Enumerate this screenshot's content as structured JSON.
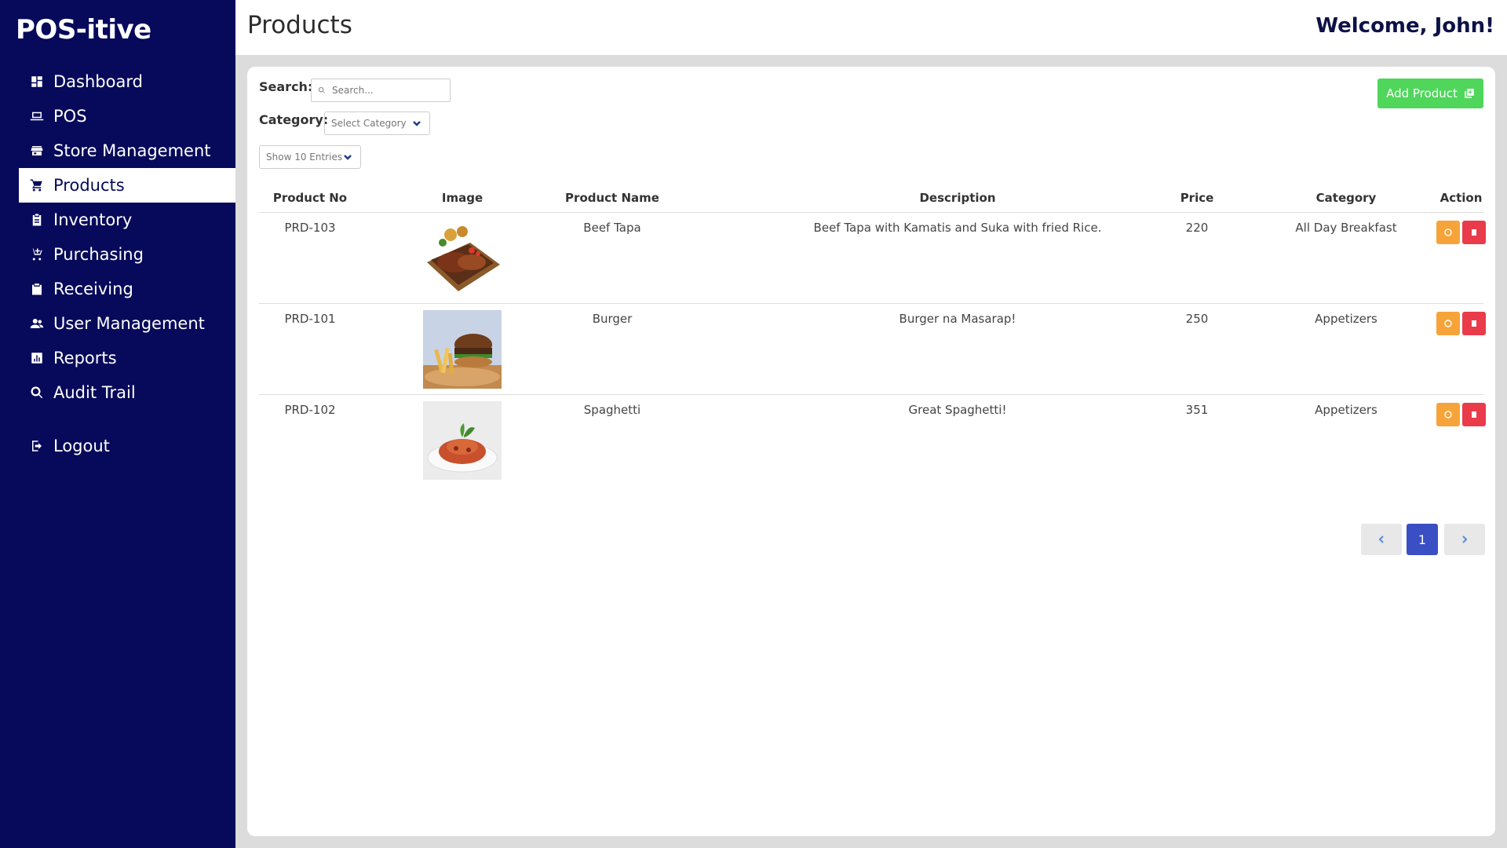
{
  "app": {
    "brand": "POS-itive"
  },
  "sidebar": {
    "items": [
      {
        "label": "Dashboard",
        "icon": "dashboard-icon"
      },
      {
        "label": "POS",
        "icon": "laptop-icon"
      },
      {
        "label": "Store Management",
        "icon": "store-icon"
      },
      {
        "label": "Products",
        "icon": "cart-icon",
        "active": true
      },
      {
        "label": "Inventory",
        "icon": "clipboard-icon"
      },
      {
        "label": "Purchasing",
        "icon": "cart-plus-icon"
      },
      {
        "label": "Receiving",
        "icon": "package-icon"
      },
      {
        "label": "User Management",
        "icon": "users-icon"
      },
      {
        "label": "Reports",
        "icon": "chart-icon"
      },
      {
        "label": "Audit Trail",
        "icon": "search-icon"
      }
    ],
    "logout": "Logout"
  },
  "header": {
    "title": "Products",
    "welcome": "Welcome, John!"
  },
  "filters": {
    "search_label": "Search:",
    "search_placeholder": "Search...",
    "category_label": "Category:",
    "category_selected": "Select Category",
    "entries_selected": "Show 10 Entries"
  },
  "actions": {
    "add_product": "Add Product"
  },
  "table": {
    "columns": [
      "Product No",
      "Image",
      "Product Name",
      "Description",
      "Price",
      "Category",
      "Action"
    ],
    "rows": [
      {
        "product_no": "PRD-103",
        "image": "beef-tapa-photo",
        "name": "Beef Tapa",
        "description": "Beef Tapa with Kamatis and Suka with fried Rice.",
        "price": "220",
        "category": "All Day Breakfast"
      },
      {
        "product_no": "PRD-101",
        "image": "burger-photo",
        "name": "Burger",
        "description": "Burger na Masarap!",
        "price": "250",
        "category": "Appetizers"
      },
      {
        "product_no": "PRD-102",
        "image": "spaghetti-photo",
        "name": "Spaghetti",
        "description": "Great Spaghetti!",
        "price": "351",
        "category": "Appetizers"
      }
    ]
  },
  "pagination": {
    "current": "1"
  },
  "colors": {
    "sidebar": "#070a5a",
    "add_button": "#4fd65b",
    "edit": "#f6a43a",
    "delete": "#ea3b4b",
    "page_active": "#3a4fc4"
  }
}
